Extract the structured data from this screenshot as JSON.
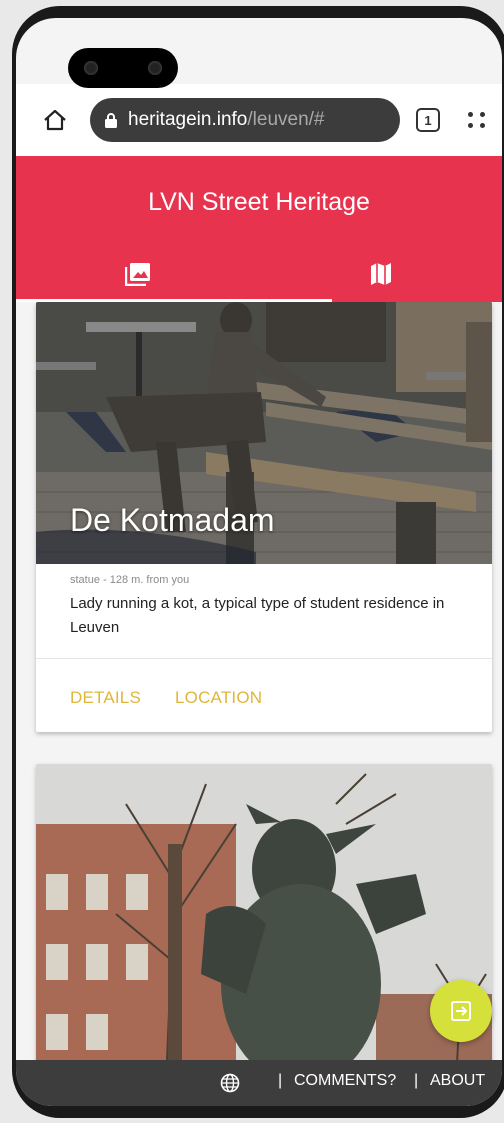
{
  "browser": {
    "url_host": "heritagein.info",
    "url_path": "/leuven/#",
    "tab_count": "1"
  },
  "app": {
    "title": "LVN Street Heritage",
    "tabs": [
      {
        "icon": "photo-gallery-icon"
      },
      {
        "icon": "map-icon"
      }
    ],
    "accent_color": "#e8334f"
  },
  "cards": [
    {
      "title": "De Kotmadam",
      "meta": "statue - 128 m. from you",
      "description": "Lady running a kot, a typical type of student residence in Leuven",
      "actions": [
        "DETAILS",
        "LOCATION"
      ]
    },
    {
      "title": "",
      "meta": "",
      "description": ""
    }
  ],
  "fab": {
    "icon": "exit-login-icon",
    "color": "#d6e03a"
  },
  "footer": {
    "separator": "|",
    "comments_label": "COMMENTS?",
    "about_label": "ABOUT"
  }
}
